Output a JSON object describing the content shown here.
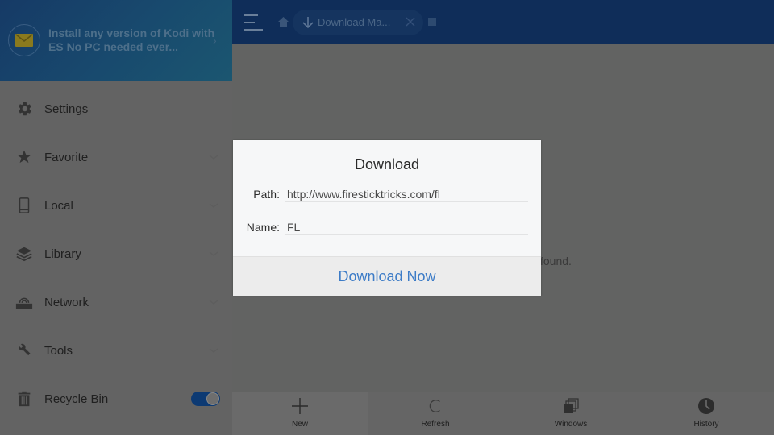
{
  "banner": {
    "icon": "mail-icon",
    "text": "Install any version of Kodi with ES No PC needed ever...",
    "arrow": "›"
  },
  "sidebar": {
    "items": [
      {
        "label": "Settings",
        "icon": "gear-icon",
        "expandable": false
      },
      {
        "label": "Favorite",
        "icon": "star-icon",
        "expandable": true
      },
      {
        "label": "Local",
        "icon": "phone-icon",
        "expandable": true
      },
      {
        "label": "Library",
        "icon": "layers-icon",
        "expandable": true
      },
      {
        "label": "Network",
        "icon": "router-icon",
        "expandable": true
      },
      {
        "label": "Tools",
        "icon": "wrench-icon",
        "expandable": true
      },
      {
        "label": "Recycle Bin",
        "icon": "trash-icon",
        "toggle": true,
        "toggle_on": true
      }
    ]
  },
  "header": {
    "tab_label": "Download Ma...",
    "tab_icon": "download-arrow-icon"
  },
  "main": {
    "empty_text": "found."
  },
  "toolbar": {
    "items": [
      {
        "label": "New",
        "icon": "plus-icon"
      },
      {
        "label": "Refresh",
        "icon": "refresh-icon"
      },
      {
        "label": "Windows",
        "icon": "windows-icon"
      },
      {
        "label": "History",
        "icon": "clock-icon"
      }
    ]
  },
  "dialog": {
    "title": "Download",
    "path_label": "Path:",
    "path_value": "http://www.firesticktricks.com/fl",
    "name_label": "Name:",
    "name_value": "FL",
    "button_label": "Download Now",
    "accent_color": "#3d7cc7"
  }
}
